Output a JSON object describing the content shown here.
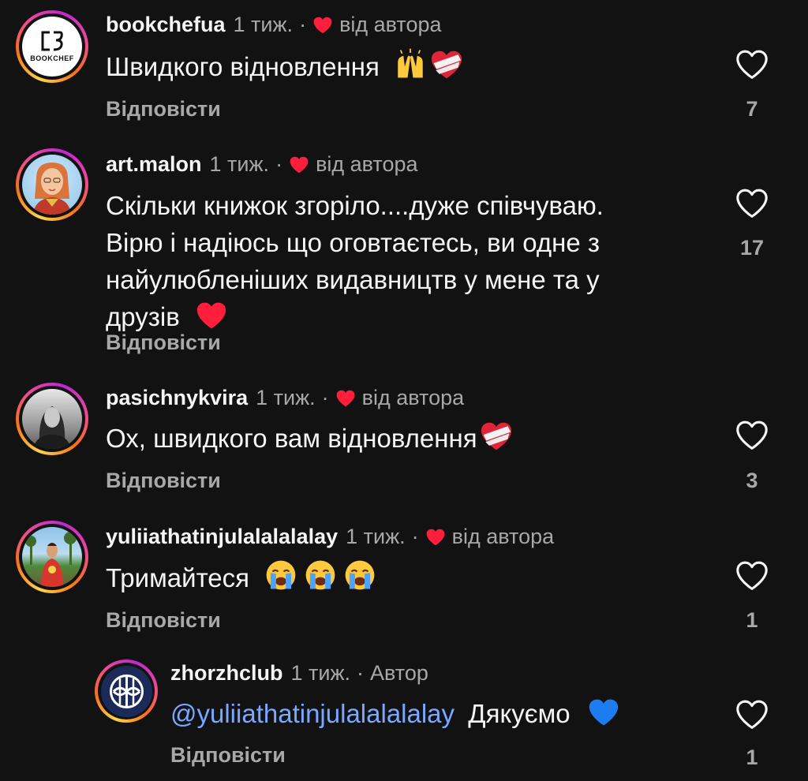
{
  "colors": {
    "background": "#121212",
    "text_primary": "#f5f5f5",
    "text_secondary": "#a8a8a8",
    "mention": "#7aa7ff",
    "author_like_heart": "#ff1f3d"
  },
  "comments": [
    {
      "username": "bookchefua",
      "time": "1 тиж.",
      "separator": "·",
      "author_like_label": "від автора",
      "text": "Швидкого відновлення",
      "emojis": [
        "raising-hands-emoji",
        "mending-heart-emoji"
      ],
      "reply_label": "Відповісти",
      "likes": "7",
      "avatar": "bookchef-logo-avatar",
      "avatar_text": "BOOKCHEF"
    },
    {
      "username": "art.malon",
      "time": "1 тиж.",
      "separator": "·",
      "author_like_label": "від автора",
      "text_lines": [
        "Скільки книжок згоріло....дуже співчуваю.",
        "Вірю і надіюсь що оговтаєтесь, ви одне з",
        "найулюбленіших видавництв у мене та у",
        "друзів"
      ],
      "emojis": [
        "red-heart-emoji"
      ],
      "reply_label": "Відповісти",
      "likes": "17",
      "avatar": "illustrated-woman-avatar"
    },
    {
      "username": "pasichnykvira",
      "time": "1 тиж.",
      "separator": "·",
      "author_like_label": "від автора",
      "text": "Ох, швидкого вам відновлення",
      "emojis": [
        "mending-heart-emoji"
      ],
      "reply_label": "Відповісти",
      "likes": "3",
      "avatar": "bw-photo-avatar"
    },
    {
      "username": "yuliiathatinjulalalalalay",
      "time": "1 тиж.",
      "separator": "·",
      "author_like_label": "від автора",
      "text": "Тримайтеся",
      "emojis": [
        "loudly-crying-emoji",
        "loudly-crying-emoji",
        "loudly-crying-emoji"
      ],
      "reply_label": "Відповісти",
      "likes": "1",
      "avatar": "outdoor-photo-avatar"
    }
  ],
  "reply": {
    "username": "zhorzhclub",
    "time": "1 тиж.",
    "separator": "·",
    "role_label": "Автор",
    "mention": "@yuliiathatinjulalalalalay",
    "text": "Дякуємо",
    "emojis": [
      "blue-heart-emoji"
    ],
    "reply_label": "Відповісти",
    "likes": "1",
    "avatar": "zhorzh-club-logo-avatar"
  }
}
